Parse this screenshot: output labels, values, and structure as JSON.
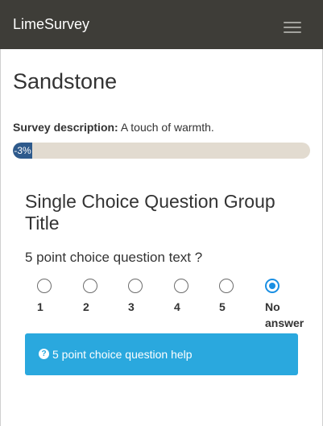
{
  "navbar": {
    "brand": "LimeSurvey",
    "menu_icon": "hamburger-menu-icon"
  },
  "survey": {
    "title": "Sandstone",
    "description_label": "Survey description:",
    "description_text": "A touch of warmth."
  },
  "progress": {
    "label": "-3%",
    "value_percent": -3
  },
  "group": {
    "title": "Single Choice Question Group Title"
  },
  "question": {
    "text": "5 point choice question text ?",
    "options": [
      {
        "label": "1",
        "selected": false
      },
      {
        "label": "2",
        "selected": false
      },
      {
        "label": "3",
        "selected": false
      },
      {
        "label": "4",
        "selected": false
      },
      {
        "label": "5",
        "selected": false
      },
      {
        "label": "No answer",
        "selected": true
      }
    ],
    "help_icon": "question-circle-icon",
    "help_text": "5 point choice question help"
  },
  "colors": {
    "navbar_bg": "#3e3d38",
    "progress_fill": "#2e5a8c",
    "progress_track": "#e2dbd0",
    "help_bg": "#2aa8de",
    "radio_selected": "#1a8fe3"
  }
}
